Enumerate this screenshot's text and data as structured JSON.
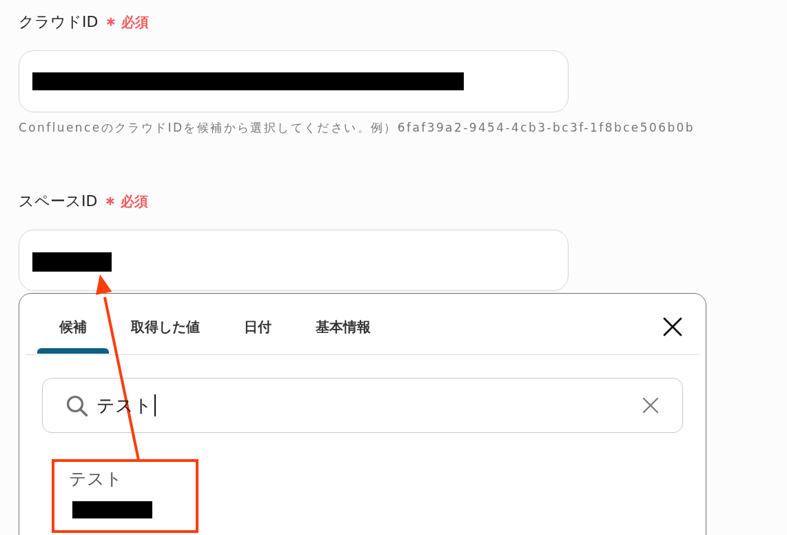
{
  "fields": [
    {
      "label": "クラウドID",
      "required_mark": "＊",
      "required_label": "必須",
      "value_redacted": true,
      "help": "ConfluenceのクラウドIDを候補から選択してください。例）6faf39a2-9454-4cb3-bc3f-1f8bce506b0b"
    },
    {
      "label": "スペースID",
      "required_mark": "＊",
      "required_label": "必須",
      "value_redacted": true
    }
  ],
  "picker": {
    "tabs": [
      {
        "label": "候補",
        "selected": true
      },
      {
        "label": "取得した値",
        "selected": false
      },
      {
        "label": "日付",
        "selected": false
      },
      {
        "label": "基本情報",
        "selected": false
      }
    ],
    "search": {
      "value": "テスト",
      "focused": true
    },
    "results": [
      {
        "title": "テスト",
        "detail_redacted": true,
        "highlighted": true
      }
    ]
  },
  "pointer_arrow": true
}
